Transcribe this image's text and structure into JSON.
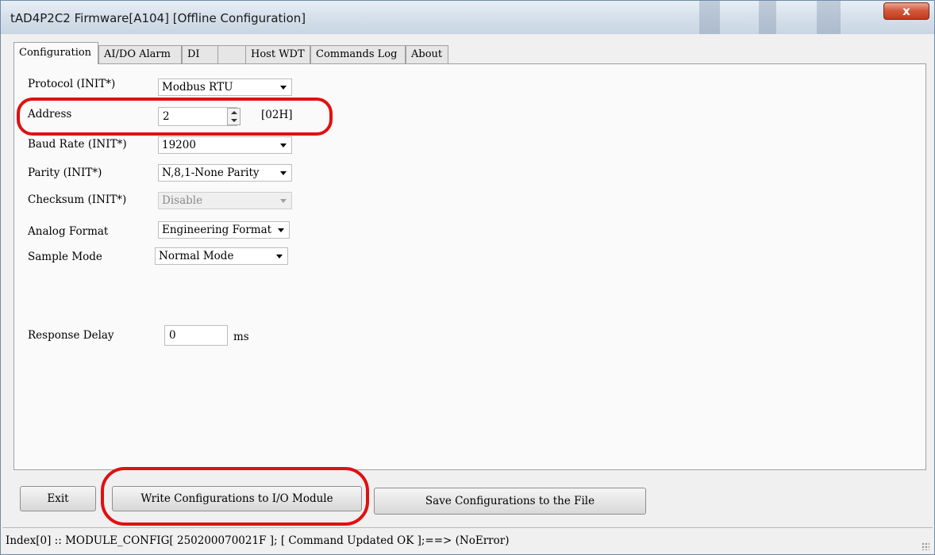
{
  "window": {
    "title": "tAD4P2C2 Firmware[A104] [Offline Configuration]",
    "close_label": "x"
  },
  "tabs": [
    {
      "label": "Configuration"
    },
    {
      "label": "AI/DO Alarm"
    },
    {
      "label": "DI"
    },
    {
      "label": "Host WDT"
    },
    {
      "label": "Commands Log"
    },
    {
      "label": "About"
    }
  ],
  "form": {
    "protocol": {
      "label": "Protocol (INIT*)",
      "value": "Modbus RTU"
    },
    "address": {
      "label": "Address",
      "value": "2",
      "hex": "[02H]"
    },
    "baud_rate": {
      "label": "Baud Rate (INIT*)",
      "value": "19200"
    },
    "parity": {
      "label": "Parity (INIT*)",
      "value": "N,8,1-None Parity"
    },
    "checksum": {
      "label": "Checksum (INIT*)",
      "value": "Disable"
    },
    "analog_format": {
      "label": "Analog Format",
      "value": "Engineering Format"
    },
    "sample_mode": {
      "label": "Sample Mode",
      "value": "Normal Mode"
    },
    "response_delay": {
      "label": "Response Delay",
      "value": "0",
      "unit": "ms"
    }
  },
  "buttons": {
    "exit": "Exit",
    "write": "Write Configurations to I/O Module",
    "save": "Save Configurations to the File"
  },
  "status": {
    "text": "Index[0] :: MODULE_CONFIG[ 250200070021F ]; [ Command Updated OK ];==> (NoError)"
  },
  "colors": {
    "highlight": "#e01010",
    "close_button": "#c23a1c"
  }
}
